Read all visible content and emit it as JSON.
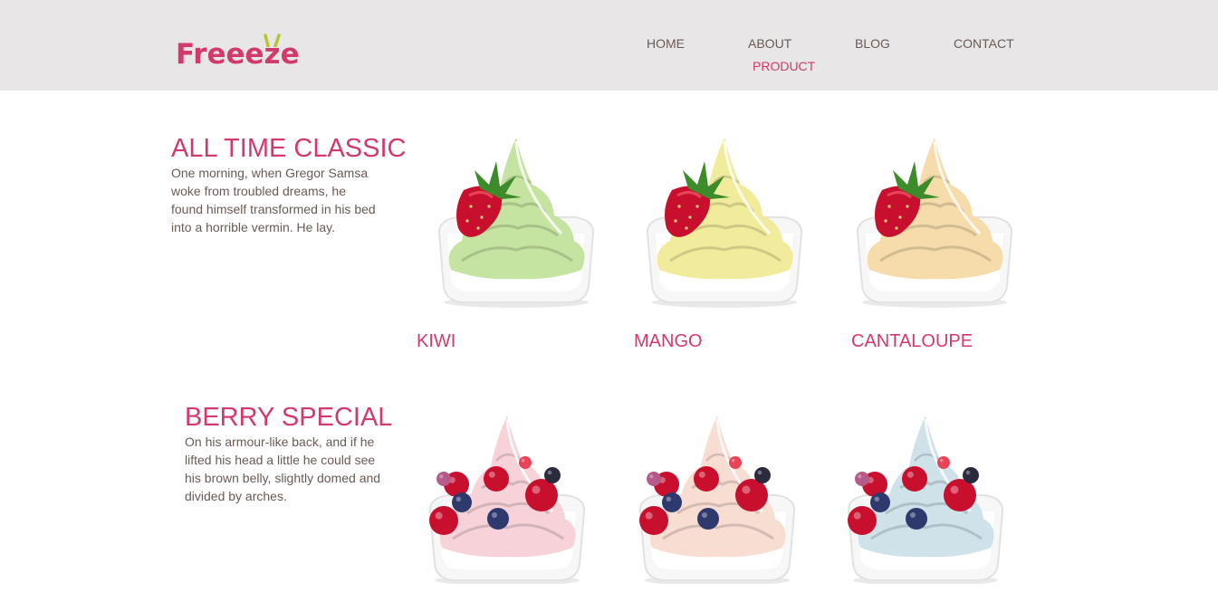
{
  "brand": {
    "name": "Freeeze",
    "color": "#d23a6b",
    "accent": "#b9c52a"
  },
  "nav": {
    "home": "HOME",
    "about": "ABOUT",
    "blog": "BLOG",
    "contact": "CONTACT",
    "product": "PRODUCT",
    "active": "product"
  },
  "sections": [
    {
      "title": "ALL TIME CLASSIC",
      "description": "One morning, when Gregor Samsa woke from troubled dreams, he found himself transformed in his bed into a horrible vermin. He lay.",
      "products": [
        {
          "name": "KIWI",
          "image_icon": "kiwi-frozen-yogurt-image",
          "cream_color": "#c5e3a1"
        },
        {
          "name": "MANGO",
          "image_icon": "mango-frozen-yogurt-image",
          "cream_color": "#f1ec9c"
        },
        {
          "name": "CANTALOUPE",
          "image_icon": "cantaloupe-frozen-yogurt-image",
          "cream_color": "#f6dcaa"
        }
      ]
    },
    {
      "title": "BERRY SPECIAL",
      "description": "On his armour-like back, and if he lifted his head a little he could see his brown belly, slightly domed and divided by arches.",
      "products": [
        {
          "image_icon": "pink-berry-frozen-yogurt-image",
          "cream_color": "#f7d2d8"
        },
        {
          "image_icon": "peach-berry-frozen-yogurt-image",
          "cream_color": "#f8ddd2"
        },
        {
          "image_icon": "blue-berry-frozen-yogurt-image",
          "cream_color": "#cfe2ea"
        }
      ]
    }
  ]
}
